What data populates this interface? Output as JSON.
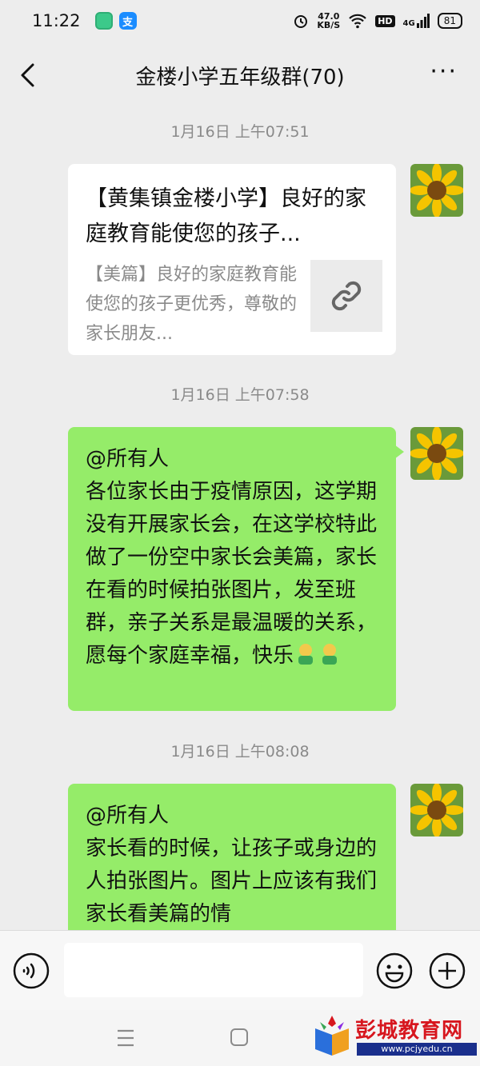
{
  "status_bar": {
    "time": "11:22",
    "speed_value": "47.0",
    "speed_unit": "KB/S",
    "hd": "HD",
    "network": "4G",
    "battery": "81"
  },
  "header": {
    "title": "金楼小学五年级群(70)",
    "more": "···"
  },
  "messages": [
    {
      "timestamp": "1月16日 上午07:51",
      "type": "link",
      "title": "【黄集镇金楼小学】良好的家庭教育能使您的孩子...",
      "description": "【美篇】良好的家庭教育能使您的孩子更优秀，尊敬的家长朋友...",
      "icon": "link-icon"
    },
    {
      "timestamp": "1月16日 上午07:58",
      "type": "text",
      "text": "@所有人\n各位家长由于疫情原因，这学期没有开展家长会，在这学校特此做了一份空中家长会美篇，家长在看的时候拍张图片，发至班群，亲子关系是最温暖的关系，愿每个家庭幸福，快乐"
    },
    {
      "timestamp": "1月16日 上午08:08",
      "type": "text",
      "text": "@所有人\n家长看的时候，让孩子或身边的人拍张图片。图片上应该有我们家长看美篇的情"
    }
  ],
  "input_bar": {
    "placeholder": ""
  },
  "watermark": {
    "name": "彭城教育网",
    "url": "www.pcjyedu.cn"
  },
  "colors": {
    "bubble": "#95ec69",
    "background": "#ededed",
    "timestamp": "#8a8a8a"
  }
}
